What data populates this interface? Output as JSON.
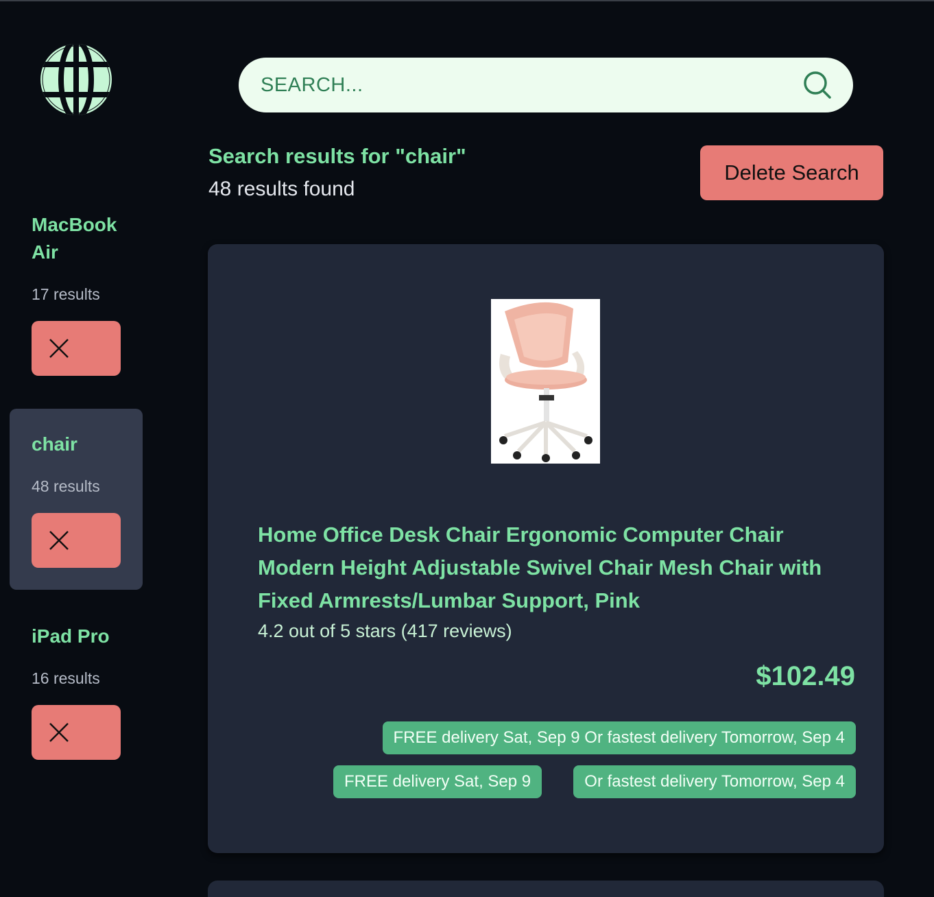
{
  "logo": {
    "icon": "globe-icon",
    "color": "#c6f6d5"
  },
  "sidebar": {
    "items": [
      {
        "title": "MacBook Air",
        "count": "17 results",
        "active": false,
        "delete_icon": "close-icon"
      },
      {
        "title": "chair",
        "count": "48 results",
        "active": true,
        "delete_icon": "close-icon"
      },
      {
        "title": "iPad Pro",
        "count": "16 results",
        "active": false,
        "delete_icon": "close-icon"
      }
    ]
  },
  "search": {
    "placeholder": "SEARCH...",
    "value": "",
    "icon": "search-icon"
  },
  "header": {
    "title": "Search results for \"chair\"",
    "count": "48 results found",
    "delete_label": "Delete Search"
  },
  "results": [
    {
      "title": "Home Office Desk Chair Ergonomic Computer Chair Modern Height Adjustable Swivel Chair Mesh Chair with Fixed Armrests/Lumbar Support, Pink",
      "rating": "4.2 out of 5 stars (417 reviews)",
      "price": "$102.49",
      "badges": [
        "FREE delivery Sat, Sep 9 Or fastest delivery Tomorrow, Sep 4",
        "FREE delivery Sat, Sep 9",
        "Or fastest delivery Tomorrow, Sep 4"
      ]
    }
  ],
  "colors": {
    "background": "#080c12",
    "card": "#212838",
    "accent": "#7ee2a4",
    "danger": "#e77b76",
    "badge": "#50b381"
  }
}
